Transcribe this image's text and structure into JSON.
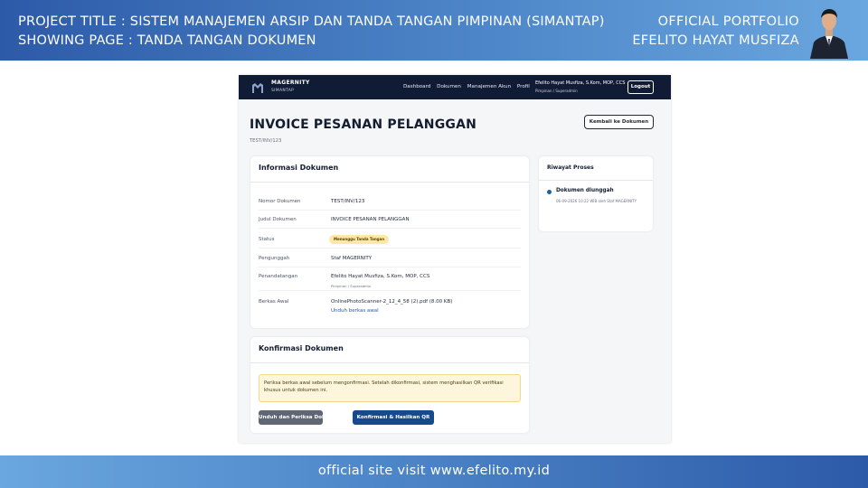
{
  "banner": {
    "project_line": "PROJECT TITLE  : SISTEM MANAJEMEN ARSIP DAN TANDA TANGAN PIMPINAN (SIMANTAP)",
    "page_line": "SHOWING PAGE : TANDA TANGAN DOKUMEN",
    "portfolio": "OFFICIAL PORTFOLIO",
    "author": "EFELITO HAYAT MUSFIZA"
  },
  "footer": {
    "text": "official site visit www.efelito.my.id"
  },
  "app": {
    "brand": "MAGERNITY",
    "brand_sub": "SIMANTAP",
    "nav": [
      "Dashboard",
      "Dokumen",
      "Manajemen Akun",
      "Profil"
    ],
    "user_name": "Efelito Hayat Musfiza, S.Kom, MOP, CCS",
    "user_role": "Pimpinan / Superadmin",
    "logout": "Logout",
    "title": "INVOICE PESANAN PELANGGAN",
    "doc_number": "TEST/INV/123",
    "back_button": "Kembali ke Dokumen",
    "info": {
      "title": "Informasi Dokumen",
      "rows": [
        {
          "label": "Nomor Dokumen",
          "value": "TEST/INV/123"
        },
        {
          "label": "Judul Dokumen",
          "value": "INVOICE PESANAN PELANGGAN"
        },
        {
          "label": "Status",
          "value": "Menunggu Tanda Tangan"
        },
        {
          "label": "Pengunggah",
          "value": "Staf MAGERNITY"
        },
        {
          "label": "Penandatangan",
          "value": "Efelito Hayat Musfiza, S.Kom, MOP, CCS",
          "sub": "Pimpinan / Superadmin"
        },
        {
          "label": "Berkas Awal",
          "value": "OnlinePhotoScanner-2_12_4_58 (2).pdf (8.00 KB)",
          "link": "Unduh berkas awal"
        }
      ]
    },
    "confirm": {
      "title": "Konfirmasi Dokumen",
      "notice": "Periksa berkas awal sebelum mengonfirmasi. Setelah dikonfirmasi, sistem menghasilkan QR verifikasi khusus untuk dokumen ini.",
      "btn_download": "Unduh dan Periksa Dokumen",
      "btn_confirm": "Konfirmasi & Hasilkan QR"
    },
    "history": {
      "title": "Riwayat Proses",
      "item_title": "Dokumen diunggah",
      "item_meta": "06-09-2026 10:22 WIB oleh Staf MAGERNITY"
    }
  },
  "colors": {
    "nav_bg": "#101b35",
    "accent": "#174a8c",
    "badge": "#fde8a8"
  }
}
